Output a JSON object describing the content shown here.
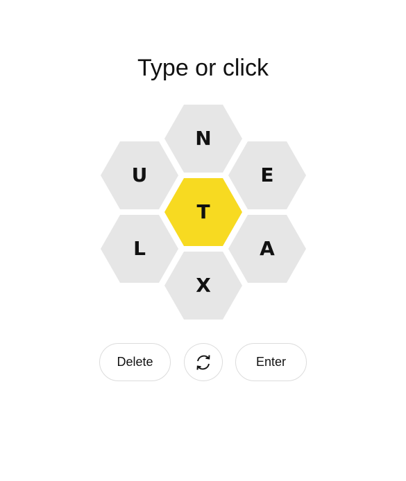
{
  "prompt": "Type or click",
  "hive": {
    "center_letter": "T",
    "outer_letters": {
      "top": "N",
      "upper_left": "U",
      "upper_right": "E",
      "lower_left": "L",
      "lower_right": "A",
      "bottom": "X"
    },
    "colors": {
      "center": "#f7da21",
      "outer": "#e6e6e6"
    }
  },
  "controls": {
    "delete_label": "Delete",
    "shuffle_icon": "shuffle-icon",
    "enter_label": "Enter"
  }
}
